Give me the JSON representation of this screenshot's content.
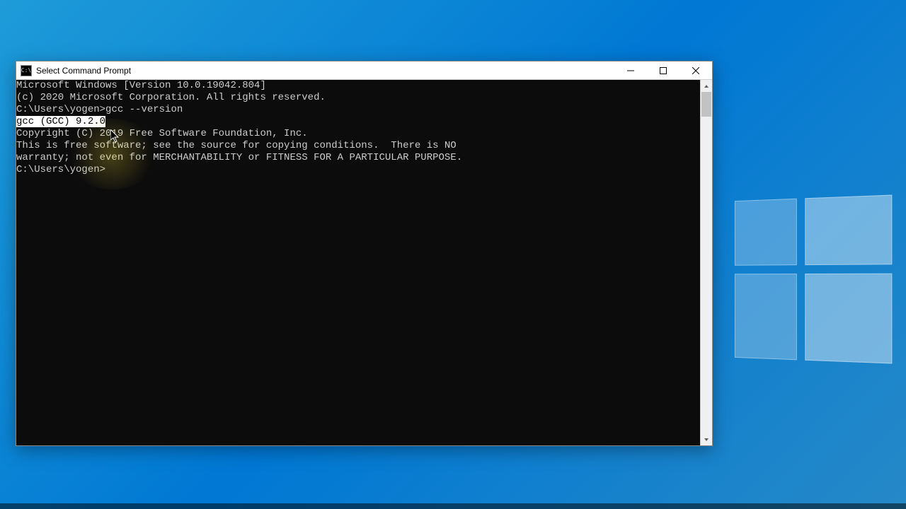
{
  "window": {
    "title": "Select Command Prompt"
  },
  "terminal": {
    "line1": "Microsoft Windows [Version 10.0.19042.804]",
    "line2": "(c) 2020 Microsoft Corporation. All rights reserved.",
    "line3": "",
    "prompt1": "C:\\Users\\yogen>",
    "command1": "gcc --version",
    "selected_text": "gcc (GCC) 9.2.0",
    "line5": "Copyright (C) 2019 Free Software Foundation, Inc.",
    "line6": "This is free software; see the source for copying conditions.  There is NO",
    "line7": "warranty; not even for MERCHANTABILITY or FITNESS FOR A PARTICULAR PURPOSE.",
    "line8": "",
    "prompt2": "C:\\Users\\yogen>"
  }
}
